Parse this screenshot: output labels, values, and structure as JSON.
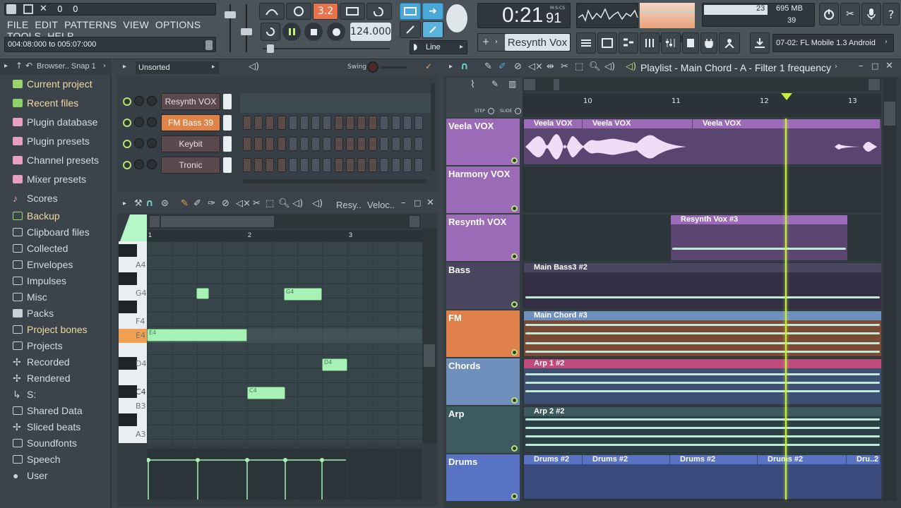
{
  "menu": [
    "FILE",
    "EDIT",
    "PATTERNS",
    "VIEW",
    "OPTIONS",
    "TOOLS",
    "HELP"
  ],
  "top": {
    "counter_a": "0",
    "counter_b": "0",
    "time_range": "004:08:000 to 005:07:000",
    "pattern_num": "3.2",
    "tempo": "124.000",
    "time_main": "0:21",
    "time_sub": "91",
    "time_unit": "M:S:CS",
    "snap_mode": "Line",
    "channel_sel": "Resynth Vox",
    "cpu_num": "23",
    "mem": "695 MB",
    "poly": "39",
    "news": "07-02: FL Mobile 1.3 Android"
  },
  "browser": {
    "title": "Browser.. Snap 1",
    "items": [
      "Current project",
      "Recent files",
      "Plugin database",
      "Plugin presets",
      "Channel presets",
      "Mixer presets",
      "Scores",
      "Backup",
      "Clipboard files",
      "Collected",
      "Envelopes",
      "Impulses",
      "Misc",
      "Packs",
      "Project bones",
      "Projects",
      "Recorded",
      "Rendered",
      "S:",
      "Shared Data",
      "Sliced beats",
      "Soundfonts",
      "Speech",
      "User"
    ]
  },
  "rack": {
    "filter": "Unsorted",
    "swing_label": "Swing",
    "channels": [
      "Resynth VOX",
      "FM Bass 39",
      "Keybit",
      "Tronic"
    ]
  },
  "piano_roll": {
    "target": "Resy..",
    "param": "Veloc..",
    "bars": [
      "1",
      "2",
      "3"
    ],
    "keys": [
      "A4",
      "G4",
      "F4",
      "E4",
      "D4",
      "C4",
      "B3",
      "A3"
    ],
    "notes": [
      "E4",
      "G4",
      "G4",
      "C4",
      "D4"
    ]
  },
  "playlist": {
    "title": "Playlist - Main Chord - A - Filter 1 frequency",
    "step_label": "STEP",
    "slide_label": "SLIDE",
    "bars": [
      "10",
      "11",
      "12",
      "13"
    ],
    "tracks": [
      "Veela VOX",
      "Harmony VOX",
      "Resynth VOX",
      "Bass",
      "FM",
      "Chords",
      "Arp",
      "Drums"
    ],
    "clips": {
      "veela": [
        "Veela VOX",
        "Veela VOX",
        "Veela VOX"
      ],
      "resynth": "Resynth Vox #3",
      "bass": "Main Bass3 #2",
      "fm": "Main Chord #3",
      "chords": "Arp 1 #2",
      "arp": "Arp 2 #2",
      "drums": [
        "Drums #2",
        "Drums #2",
        "Drums #2",
        "Drums #2",
        "Dru..2"
      ]
    }
  },
  "colors": {
    "accent_orange": "#e08347",
    "accent_blue": "#4aa8d8",
    "note_green": "#a7f0b6",
    "playhead": "#c7ef3c"
  }
}
